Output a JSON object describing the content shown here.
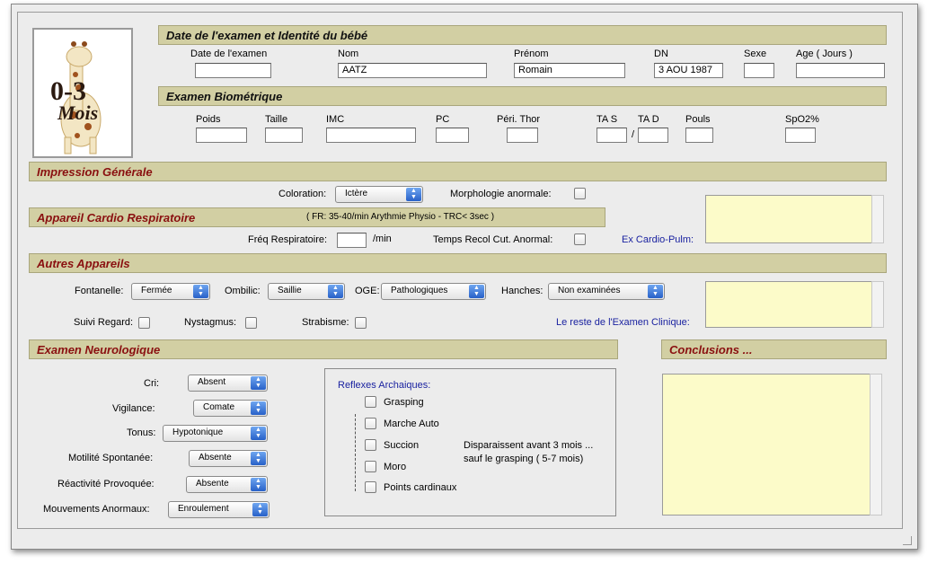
{
  "logo": {
    "text1": "0-3",
    "text2": "Mois",
    "image": "giraffe-toy-logo"
  },
  "identity": {
    "title": "Date de l'examen et Identité du bébé",
    "date_label": "Date de l'examen",
    "date_value": "",
    "nom_label": "Nom",
    "nom_value": "AATZ",
    "prenom_label": "Prénom",
    "prenom_value": "Romain",
    "dn_label": "DN",
    "dn_value": "3 AOU 1987",
    "sexe_label": "Sexe",
    "sexe_value": "",
    "age_label": "Age ( Jours )",
    "age_value": ""
  },
  "biometric": {
    "title": "Examen Biométrique",
    "poids": "Poids",
    "taille": "Taille",
    "imc": "IMC",
    "pc": "PC",
    "peri_thor": "Péri. Thor",
    "tas": "TA S",
    "tad": "TA D",
    "slash": "/",
    "pouls": "Pouls",
    "spo2": "SpO2%"
  },
  "impression": {
    "title": "Impression Générale",
    "coloration_label": "Coloration:",
    "coloration_value": "Ictère",
    "morphologie_label": "Morphologie anormale:"
  },
  "cardio": {
    "title": "Appareil Cardio Respiratoire",
    "note": "( FR: 35-40/min Arythmie Physio - TRC< 3sec )",
    "freq_label": "Fréq Respiratoire:",
    "freq_unit": "/min",
    "temps_label": "Temps Recol Cut. Anormal:",
    "ex_label": "Ex Cardio-Pulm:"
  },
  "autres": {
    "title": "Autres Appareils",
    "fontanelle_label": "Fontanelle:",
    "fontanelle_value": "Fermée",
    "ombilic_label": "Ombilic:",
    "ombilic_value": "Saillie",
    "oge_label": "OGE:",
    "oge_value": "Pathologiques",
    "hanches_label": "Hanches:",
    "hanches_value": "Non examinées",
    "suivi_label": "Suivi Regard:",
    "nystagmus_label": "Nystagmus:",
    "strabisme_label": "Strabisme:",
    "reste_label": "Le reste de l'Examen Clinique:"
  },
  "neuro": {
    "title": "Examen Neurologique",
    "cri_label": "Cri:",
    "cri_value": "Absent",
    "vigilance_label": "Vigilance:",
    "vigilance_value": "Comate",
    "tonus_label": "Tonus:",
    "tonus_value": "Hypotonique",
    "motilite_label": "Motilité Spontanée:",
    "motilite_value": "Absente",
    "reactivite_label": "Réactivité Provoquée:",
    "reactivite_value": "Absente",
    "mouvements_label": "Mouvements Anormaux:",
    "mouvements_value": "Enroulement"
  },
  "reflexes": {
    "title": "Reflexes Archaiques:",
    "grasping": "Grasping",
    "marche": "Marche Auto",
    "succion": "Succion",
    "moro": "Moro",
    "points": "Points cardinaux",
    "note1": "Disparaissent avant 3 mois ...",
    "note2": "sauf le grasping ( 5-7 mois)"
  },
  "conclusions": {
    "title": "Conclusions ..."
  },
  "colors": {
    "header_bg": "#d2cfa3",
    "header_red": "#8a1010",
    "textarea_bg": "#fcfbc9",
    "link_blue": "#1a22a0"
  }
}
